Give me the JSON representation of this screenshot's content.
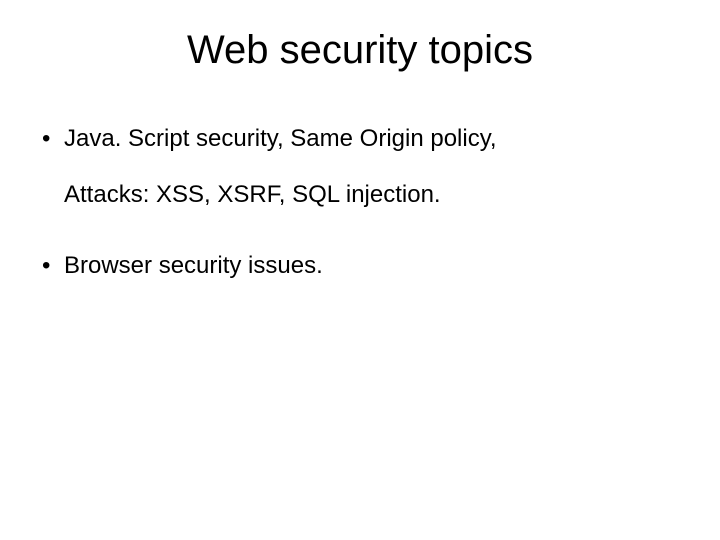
{
  "title": "Web security topics",
  "bullets": [
    {
      "line1": "Java. Script security, Same Origin policy,",
      "line2": "Attacks: XSS, XSRF, SQL injection."
    },
    {
      "line1": "Browser security issues."
    }
  ]
}
